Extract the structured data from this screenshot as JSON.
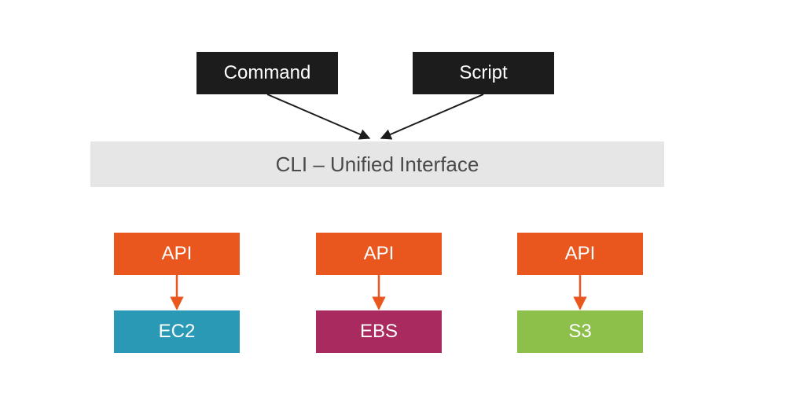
{
  "top": {
    "command": "Command",
    "script": "Script"
  },
  "middle": {
    "cli": "CLI – Unified Interface"
  },
  "apis": [
    "API",
    "API",
    "API"
  ],
  "services": [
    "EC2",
    "EBS",
    "S3"
  ],
  "colors": {
    "dark": "#1c1c1c",
    "grey": "#e6e6e6",
    "orange": "#e9571e",
    "teal": "#2a99b6",
    "magenta": "#a82a5e",
    "green": "#8cc04b"
  }
}
